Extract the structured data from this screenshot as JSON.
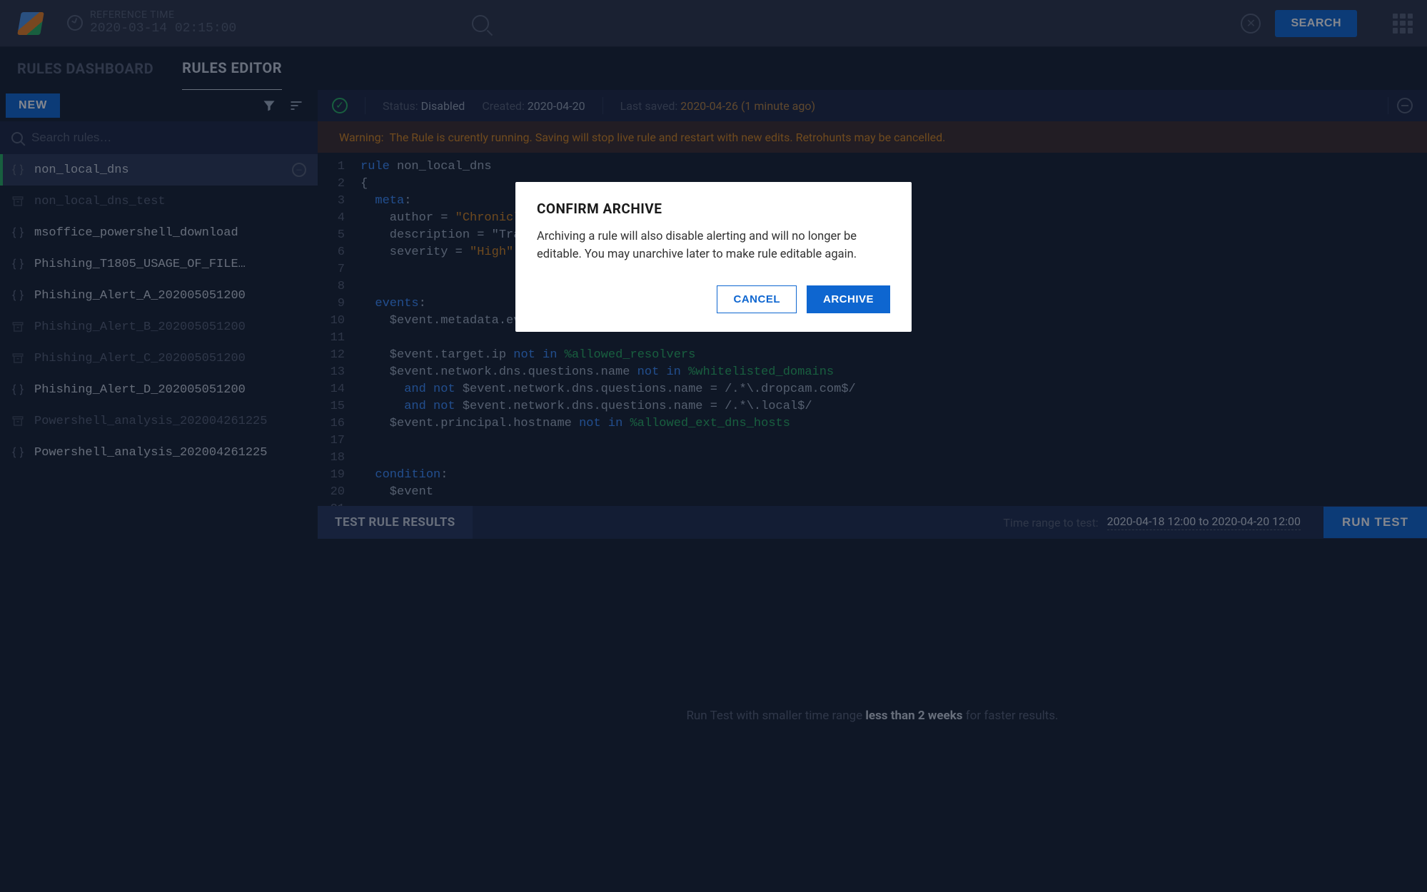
{
  "topbar": {
    "ref_label": "REFERENCE TIME",
    "ref_value": "2020-03-14 02:15:00",
    "search_label": "SEARCH"
  },
  "tabs": {
    "dashboard": "RULES DASHBOARD",
    "editor": "RULES EDITOR"
  },
  "sidebar": {
    "new_label": "NEW",
    "search_placeholder": "Search rules…",
    "rules": [
      {
        "name": "non_local_dns",
        "icon": "braces",
        "muted": false,
        "selected": true
      },
      {
        "name": "non_local_dns_test",
        "icon": "archive",
        "muted": true,
        "selected": false
      },
      {
        "name": "msoffice_powershell_download",
        "icon": "braces",
        "muted": false,
        "selected": false
      },
      {
        "name": "Phishing_T1805_USAGE_OF_FILE…",
        "icon": "braces",
        "muted": false,
        "selected": false
      },
      {
        "name": "Phishing_Alert_A_202005051200",
        "icon": "braces",
        "muted": false,
        "selected": false
      },
      {
        "name": "Phishing_Alert_B_202005051200",
        "icon": "archive",
        "muted": true,
        "selected": false
      },
      {
        "name": "Phishing_Alert_C_202005051200",
        "icon": "archive",
        "muted": true,
        "selected": false
      },
      {
        "name": "Phishing_Alert_D_202005051200",
        "icon": "braces",
        "muted": false,
        "selected": false
      },
      {
        "name": "Powershell_analysis_202004261225",
        "icon": "archive",
        "muted": true,
        "selected": false
      },
      {
        "name": "Powershell_analysis_202004261225",
        "icon": "braces",
        "muted": false,
        "selected": false
      }
    ]
  },
  "status": {
    "status_label": "Status:",
    "status_value": "Disabled",
    "created_label": "Created:",
    "created_value": "2020-04-20",
    "saved_label": "Last saved:",
    "saved_value": "2020-04-26 (1 minute ago)"
  },
  "warning": {
    "label": "Warning:",
    "text": "The Rule is curently running.  Saving will stop  live rule and restart with new edits.  Retrohunts may be cancelled."
  },
  "code": {
    "lines": [
      "rule non_local_dns",
      "{",
      "  meta:",
      "    author = \"Chronicle\"",
      "    description = \"Traffi",
      "    severity = \"High\"",
      "",
      "",
      "  events:",
      "    $event.metadata.event_type = \"NETWORK_DNS\"",
      "",
      "    $event.target.ip not in %allowed_resolvers",
      "    $event.network.dns.questions.name not in %whitelisted_domains",
      "      and not $event.network.dns.questions.name = /.*\\.dropcam.com$/",
      "      and not $event.network.dns.questions.name = /.*\\.local$/",
      "    $event.principal.hostname not in %allowed_ext_dns_hosts",
      "",
      "",
      "  condition:",
      "    $event",
      "",
      "}",
      "",
      "",
      "",
      ""
    ]
  },
  "results": {
    "title": "TEST RULE RESULTS",
    "time_label": "Time range to test:",
    "time_value": "2020-04-18 12:00 to 2020-04-20 12:00",
    "run_label": "RUN TEST",
    "hint_pre": "Run Test with smaller time range ",
    "hint_bold": "less than 2 weeks",
    "hint_post": " for faster results."
  },
  "dialog": {
    "title": "CONFIRM ARCHIVE",
    "body": "Archiving a rule will also disable alerting  and will no longer be editable. You may unarchive later to make rule editable again.",
    "cancel": "CANCEL",
    "archive": "ARCHIVE"
  }
}
